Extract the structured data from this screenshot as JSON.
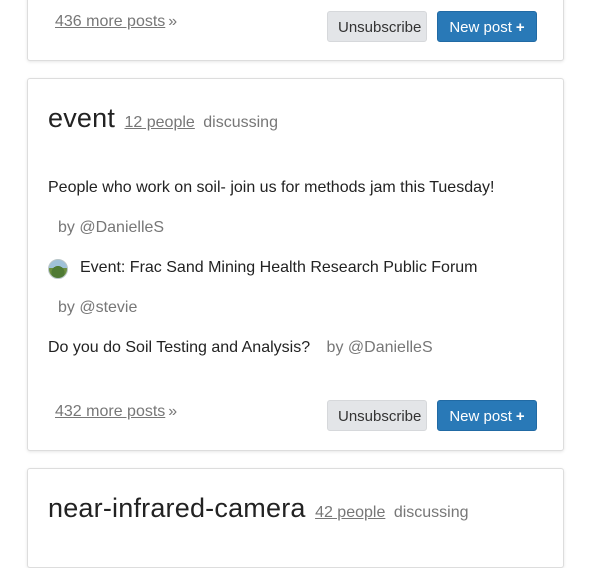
{
  "cards": [
    {
      "more_posts": "436 more posts",
      "unsubscribe": "Unsubscribe",
      "new_post": "New post"
    },
    {
      "tag": "event",
      "people": "12 people",
      "discussing": "discussing",
      "posts": [
        {
          "title": "People who work on soil- join us for methods jam this Tuesday!",
          "author": "by @DanielleS"
        },
        {
          "title": "Event: Frac Sand Mining Health Research Public Forum",
          "author": "by @stevie",
          "thumbnail": "landscape-thumbnail"
        },
        {
          "title": "Do you do Soil Testing and Analysis?",
          "author": "by @DanielleS"
        }
      ],
      "more_posts": "432 more posts",
      "unsubscribe": "Unsubscribe",
      "new_post": "New post"
    },
    {
      "tag": "near-infrared-camera",
      "people": "42 people",
      "discussing": "discussing"
    }
  ],
  "icons": {
    "chevron": "double-chevron-right-icon",
    "plus": "plus-icon"
  },
  "colors": {
    "primary_button": "#2979b7",
    "secondary_button": "#e3e5e8",
    "muted_text": "#777777"
  }
}
